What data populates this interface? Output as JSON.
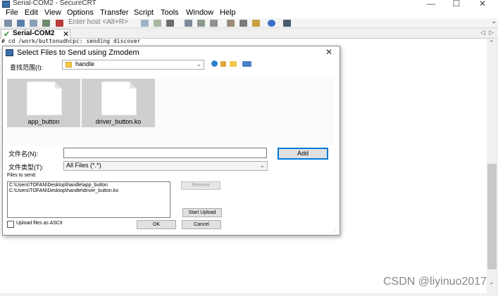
{
  "window": {
    "title": "Serial-COM2 - SecureCRT",
    "minimize": "—",
    "maximize": "☐",
    "close": "✕"
  },
  "menu": {
    "items": [
      "File",
      "Edit",
      "View",
      "Options",
      "Transfer",
      "Script",
      "Tools",
      "Window",
      "Help"
    ]
  },
  "toolbar": {
    "host_placeholder": "Enter host <Alt+R>",
    "more": "⌄"
  },
  "tab": {
    "label": "Serial-COM2",
    "close": "✕",
    "nav_left": "◁",
    "nav_right": "▷"
  },
  "terminal": {
    "line": "# cd /work/buttonudhcpc: sending discover"
  },
  "dialog": {
    "title": "Select Files to Send using Zmodem",
    "close": "✕",
    "lookin_label": "查找范围(I):",
    "lookin_value": "handle",
    "files": [
      {
        "name": "app_button"
      },
      {
        "name": "driver_button.ko"
      }
    ],
    "filename_label": "文件名(N):",
    "filename_value": "",
    "filetype_label": "文件类型(T):",
    "filetype_value": "All Files (*.*)",
    "files_to_send_label": "Files to send:",
    "files_to_send": [
      "C:\\Users\\TOFAN\\Desktop\\handle\\app_button",
      "C:\\Users\\TOFAN\\Desktop\\handle\\driver_button.ko"
    ],
    "add_button": "Add",
    "remove_button": "Remove",
    "start_upload_button": "Start Upload",
    "ok_button": "OK",
    "cancel_button": "Cancel",
    "ascii_label": "Upload files as ASCII",
    "ascii_checked": false
  },
  "watermark": "CSDN @liyinuo2017",
  "colors": {
    "accent": "#0078d7",
    "tab_check": "#2e9a2e",
    "folder": "#f5c842"
  }
}
